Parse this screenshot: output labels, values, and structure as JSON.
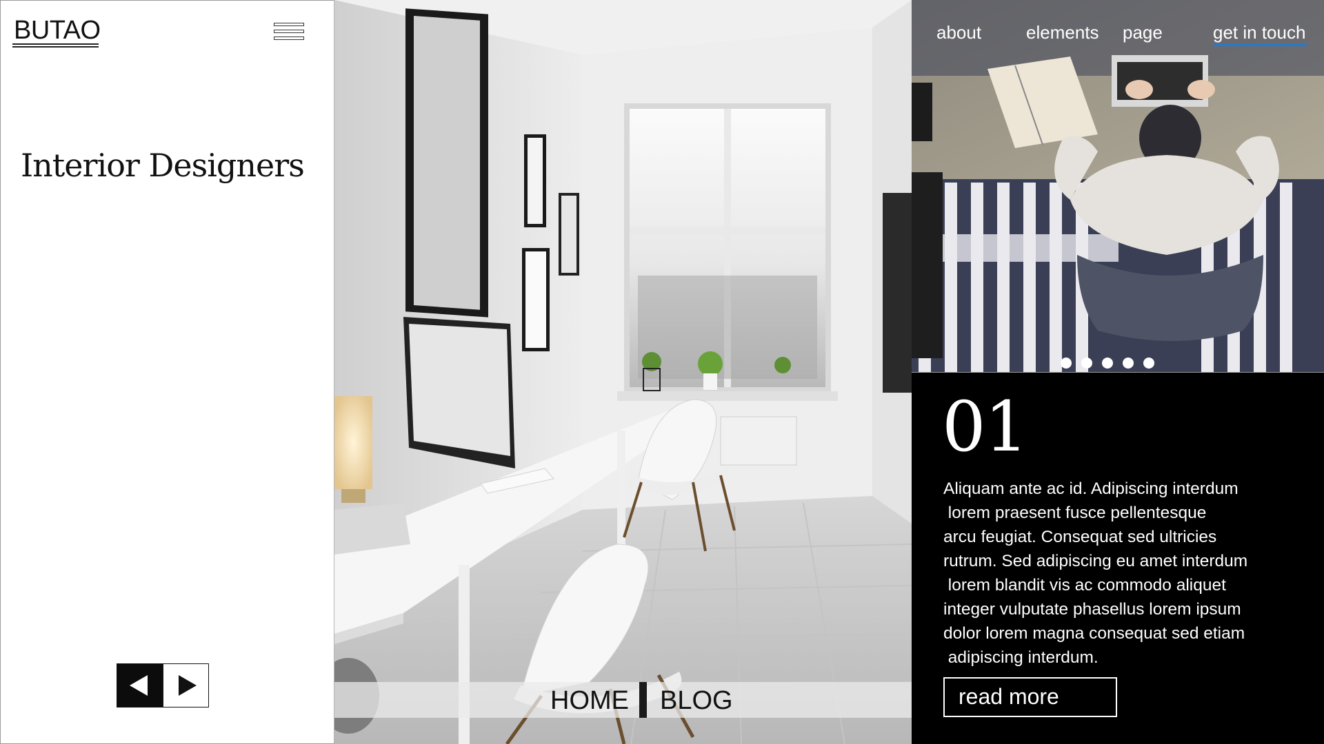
{
  "brand": {
    "logo_text": "BUTAO"
  },
  "menu": {
    "icon": "hamburger-menu-icon"
  },
  "hero_left": {
    "headline": "Interior Designers"
  },
  "slider_controls": {
    "prev_icon": "arrow-left-icon",
    "next_icon": "arrow-right-icon"
  },
  "bottom_nav": {
    "home_label": "HOME",
    "blog_label": "BLOG"
  },
  "top_nav": {
    "items": [
      {
        "label": "about"
      },
      {
        "label": "elements"
      },
      {
        "label": "page"
      },
      {
        "label": "get in touch",
        "active": true
      }
    ],
    "active_color": "#1e7bd6"
  },
  "carousel": {
    "dot_count": 5
  },
  "feature": {
    "number": "01",
    "body_lines": [
      "Aliquam ante ac id. Adipiscing interdum",
      " lorem praesent fusce pellentesque",
      "arcu feugiat. Consequat sed ultricies",
      "rutrum. Sed adipiscing eu amet interdum",
      " lorem blandit vis ac commodo aliquet",
      "integer vulputate phasellus lorem ipsum",
      "dolor lorem magna consequat sed etiam",
      " adipiscing interdum."
    ],
    "cta_label": "read more"
  },
  "colors": {
    "panel_dark": "#000000",
    "panel_light": "#ffffff",
    "accent": "#1e7bd6"
  }
}
